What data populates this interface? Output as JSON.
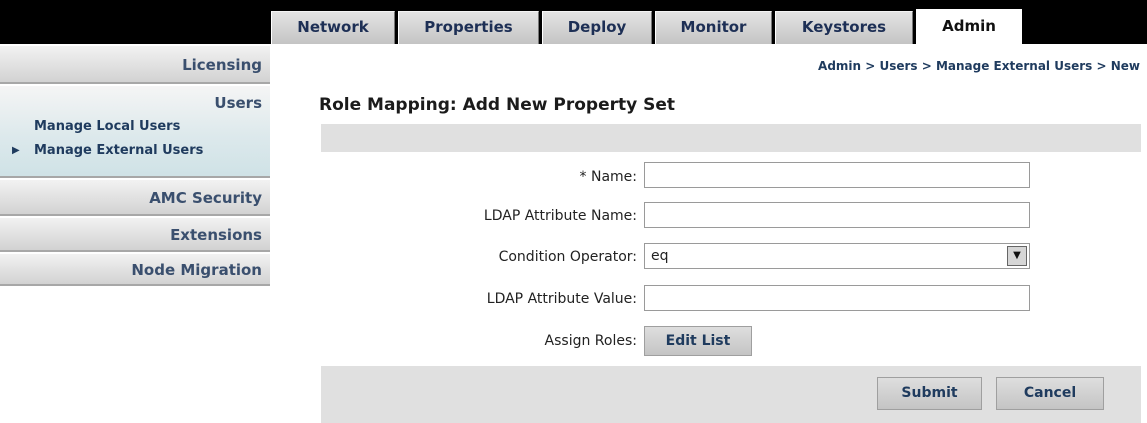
{
  "tabs": [
    {
      "label": "Network"
    },
    {
      "label": "Properties"
    },
    {
      "label": "Deploy"
    },
    {
      "label": "Monitor"
    },
    {
      "label": "Keystores"
    },
    {
      "label": "Admin",
      "active": true
    }
  ],
  "sidebar": {
    "licensing": "Licensing",
    "users": "Users",
    "manage_local_users": "Manage Local Users",
    "manage_external_users": "Manage External Users",
    "amc_security": "AMC Security",
    "extensions": "Extensions",
    "node_migration": "Node Migration"
  },
  "breadcrumb": "Admin > Users > Manage External Users > New",
  "page_title": "Role Mapping: Add New Property Set",
  "form": {
    "name_label": "* Name:",
    "name_value": "",
    "ldap_attr_name_label": "LDAP Attribute Name:",
    "ldap_attr_name_value": "",
    "condition_operator_label": "Condition Operator:",
    "condition_operator_value": "eq",
    "ldap_attr_value_label": "LDAP Attribute Value:",
    "ldap_attr_value_value": "",
    "assign_roles_label": "Assign Roles:",
    "edit_list_button": "Edit List"
  },
  "actions": {
    "submit": "Submit",
    "cancel": "Cancel"
  },
  "colors": {
    "top_bar": "#000000",
    "tab_text": "#1d2f55",
    "link_text": "#1f3b5e",
    "panel_gray": "#e0e0e0"
  }
}
